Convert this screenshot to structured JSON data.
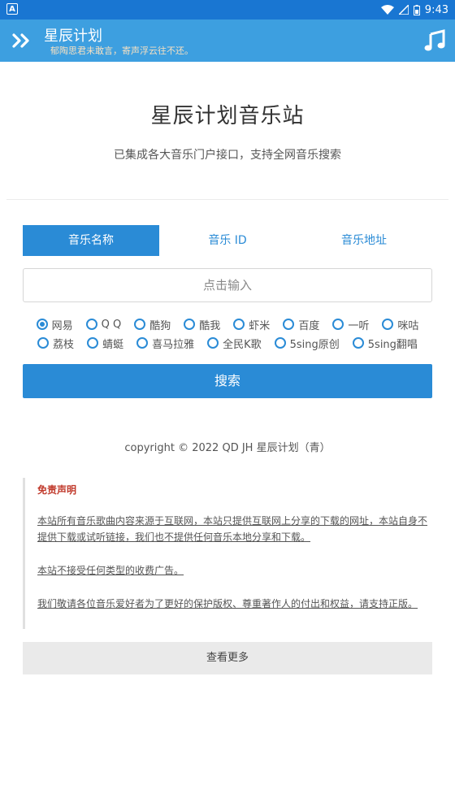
{
  "status_bar": {
    "left_badge": "A",
    "time": "9:43"
  },
  "app_bar": {
    "title": "星辰计划",
    "subtitle": "郁陶思君未敢言，寄声浮云往不还。"
  },
  "hero": {
    "title": "星辰计划音乐站",
    "subtitle": "已集成各大音乐门户接口，支持全网音乐搜索"
  },
  "tabs": [
    {
      "label": "音乐名称",
      "active": true
    },
    {
      "label": "音乐 ID",
      "active": false
    },
    {
      "label": "音乐地址",
      "active": false
    }
  ],
  "search": {
    "placeholder": "点击输入",
    "button_label": "搜索"
  },
  "sources_row1": [
    {
      "label": "网易",
      "checked": true
    },
    {
      "label": "Q Q",
      "checked": false
    },
    {
      "label": "酷狗",
      "checked": false
    },
    {
      "label": "酷我",
      "checked": false
    },
    {
      "label": "虾米",
      "checked": false
    },
    {
      "label": "百度",
      "checked": false
    },
    {
      "label": "一听",
      "checked": false
    },
    {
      "label": "咪咕",
      "checked": false
    }
  ],
  "sources_row2": [
    {
      "label": "荔枝",
      "checked": false
    },
    {
      "label": "蜻蜓",
      "checked": false
    },
    {
      "label": "喜马拉雅",
      "checked": false
    },
    {
      "label": "全民K歌",
      "checked": false
    },
    {
      "label": "5sing原创",
      "checked": false
    },
    {
      "label": "5sing翻唱",
      "checked": false
    }
  ],
  "copyright": "copyright © 2022 QD JH 星辰计划（青）",
  "disclaimer": {
    "heading": "免责声明",
    "paragraphs": [
      "本站所有音乐歌曲内容来源于互联网，本站只提供互联网上分享的下载的网址，本站自身不提供下载或试听链接，我们也不提供任何音乐本地分享和下载。",
      "本站不接受任何类型的收费广告。",
      "我们敬请各位音乐爱好者为了更好的保护版权、尊重著作人的付出和权益，请支持正版。"
    ]
  },
  "more_label": "查看更多",
  "colors": {
    "primary": "#2a8bd6",
    "app_bar": "#3d9fe0",
    "status_bar": "#1976D2",
    "disclaimer_heading": "#c0392b"
  }
}
